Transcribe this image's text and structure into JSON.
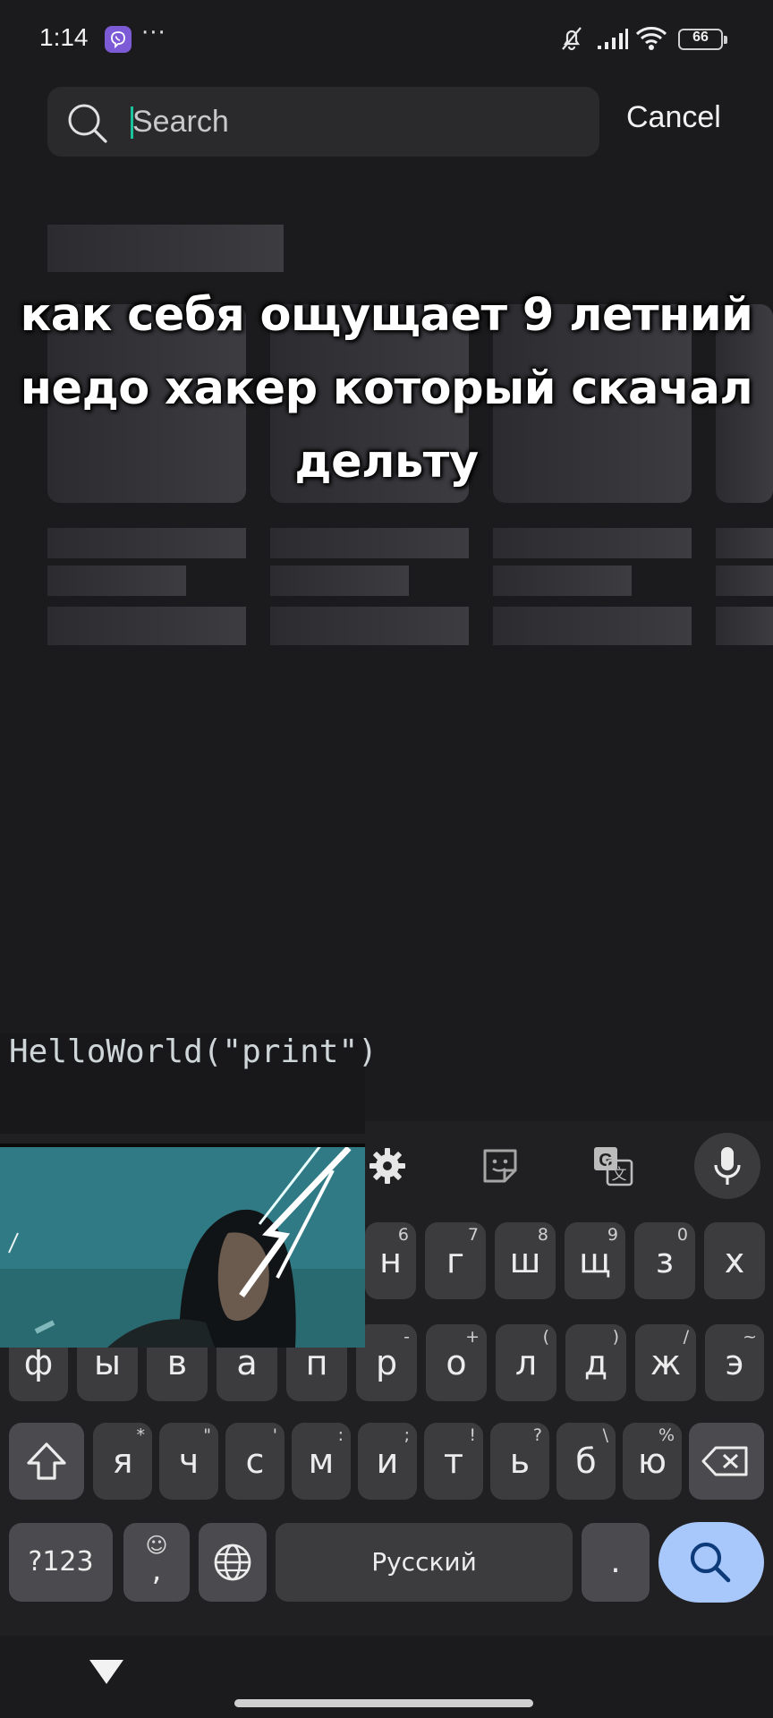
{
  "status_bar": {
    "time": "1:14",
    "more": "···",
    "battery": "66",
    "icons": [
      "viber-icon",
      "bell-off-icon",
      "signal-icon",
      "wifi-icon",
      "battery-icon"
    ]
  },
  "search": {
    "placeholder": "Search",
    "value": "",
    "cancel_label": "Cancel",
    "accent": "#19c39b"
  },
  "caption": {
    "lines": [
      "как себя ощущает 9 летний",
      "недо хакер который скачал",
      "дельту"
    ]
  },
  "meme": {
    "code_text": "HelloWorld(\"print\")"
  },
  "keyboard": {
    "toolbar": [
      "gear-icon",
      "sticker-icon",
      "translate-icon",
      "mic-icon"
    ],
    "row1": [
      {
        "label": "н",
        "sup": "6"
      },
      {
        "label": "г",
        "sup": "7"
      },
      {
        "label": "ш",
        "sup": "8"
      },
      {
        "label": "щ",
        "sup": "9"
      },
      {
        "label": "з",
        "sup": "0"
      },
      {
        "label": "х",
        "sup": ""
      }
    ],
    "row2": [
      {
        "label": "ф",
        "sup": ""
      },
      {
        "label": "ы",
        "sup": ""
      },
      {
        "label": "в",
        "sup": ""
      },
      {
        "label": "а",
        "sup": ""
      },
      {
        "label": "п",
        "sup": ""
      },
      {
        "label": "р",
        "sup": "-"
      },
      {
        "label": "о",
        "sup": "+"
      },
      {
        "label": "л",
        "sup": "("
      },
      {
        "label": "д",
        "sup": ")"
      },
      {
        "label": "ж",
        "sup": "/"
      },
      {
        "label": "э",
        "sup": "~"
      }
    ],
    "row3": [
      {
        "label": "я",
        "sup": "*"
      },
      {
        "label": "ч",
        "sup": "\""
      },
      {
        "label": "с",
        "sup": "'"
      },
      {
        "label": "м",
        "sup": ":"
      },
      {
        "label": "и",
        "sup": ";"
      },
      {
        "label": "т",
        "sup": "!"
      },
      {
        "label": "ь",
        "sup": "?"
      },
      {
        "label": "б",
        "sup": "\\"
      },
      {
        "label": "ю",
        "sup": "%"
      }
    ],
    "symbols_label": "?123",
    "emoji_sup": "☺",
    "comma_label": ",",
    "space_label": "Русский",
    "period_label": ".",
    "search_key_color": "#a8c7fa"
  }
}
